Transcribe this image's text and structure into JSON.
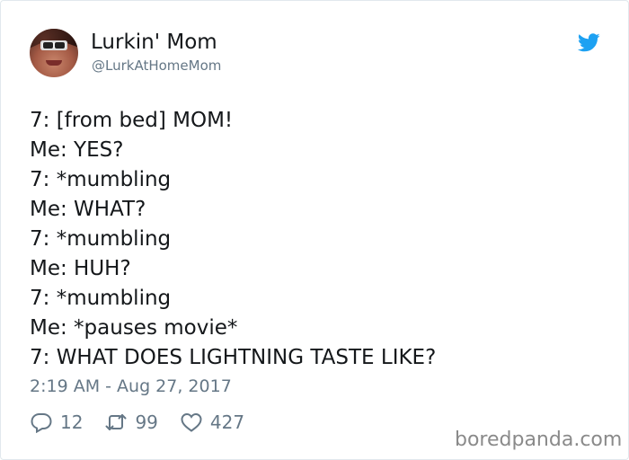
{
  "author": {
    "name": "Lurkin' Mom",
    "handle": "@LurkAtHomeMom"
  },
  "tweet": {
    "lines": [
      "7: [from bed] MOM!",
      "Me: YES?",
      "7: *mumbling",
      "Me: WHAT?",
      "7: *mumbling",
      "Me: HUH?",
      "7: *mumbling",
      "Me: *pauses movie*",
      "7: WHAT DOES LIGHTNING TASTE LIKE?"
    ],
    "timestamp": "2:19 AM - Aug 27, 2017"
  },
  "actions": {
    "replies": "12",
    "retweets": "99",
    "likes": "427"
  },
  "watermark": "boredpanda.com",
  "colors": {
    "text": "#14171a",
    "muted": "#657786",
    "twitter_blue": "#1da1f2",
    "border": "#e1e8ed"
  },
  "icons": {
    "platform": "twitter-bird-icon",
    "reply": "reply-icon",
    "retweet": "retweet-icon",
    "like": "heart-icon"
  }
}
